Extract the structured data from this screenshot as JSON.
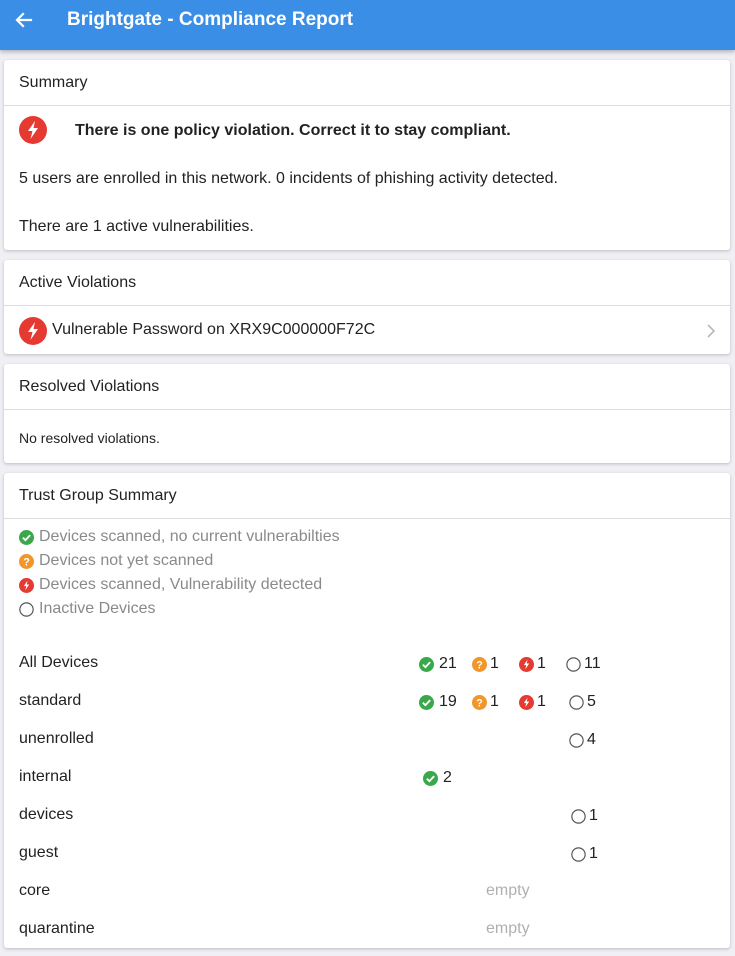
{
  "app_bar": {
    "title": "Brightgate - Compliance Report",
    "back_icon": "arrow-left-icon"
  },
  "summary": {
    "header": "Summary",
    "alert_text": "There is one policy violation. Correct it to stay compliant.",
    "users_text": "5 users are enrolled in this network. 0 incidents of phishing activity detected.",
    "vuln_text": "There are 1 active vulnerabilities."
  },
  "active_violations": {
    "header": "Active Violations",
    "items": [
      {
        "label": "Vulnerable Password on XRX9C000000F72C"
      }
    ]
  },
  "resolved_violations": {
    "header": "Resolved Violations",
    "empty_text": "No resolved violations."
  },
  "trust_group_summary": {
    "header": "Trust Group Summary",
    "legend": [
      {
        "icon": "check-circle-icon",
        "label": "Devices scanned, no current vulnerabilties"
      },
      {
        "icon": "question-circle-icon",
        "label": "Devices not yet scanned"
      },
      {
        "icon": "bolt-circle-icon",
        "label": "Devices scanned, Vulnerability detected"
      },
      {
        "icon": "empty-circle-icon",
        "label": "Inactive Devices"
      }
    ],
    "empty_label": "empty",
    "groups": [
      {
        "name": "All Devices",
        "ok": "21",
        "unscanned": "1",
        "vulnerable": "1",
        "inactive": "11"
      },
      {
        "name": "standard",
        "ok": "19",
        "unscanned": "1",
        "vulnerable": "1",
        "inactive": "5"
      },
      {
        "name": "unenrolled",
        "inactive": "4"
      },
      {
        "name": "internal",
        "ok": "2"
      },
      {
        "name": "devices",
        "inactive": "1"
      },
      {
        "name": "guest",
        "inactive": "1"
      },
      {
        "name": "core",
        "empty": true
      },
      {
        "name": "quarantine",
        "empty": true
      }
    ]
  },
  "colors": {
    "app_bar": "#3a8ee6",
    "ok": "#3aa84a",
    "unscanned": "#f2962b",
    "vulnerable": "#e53a32",
    "inactive": "#555555"
  }
}
